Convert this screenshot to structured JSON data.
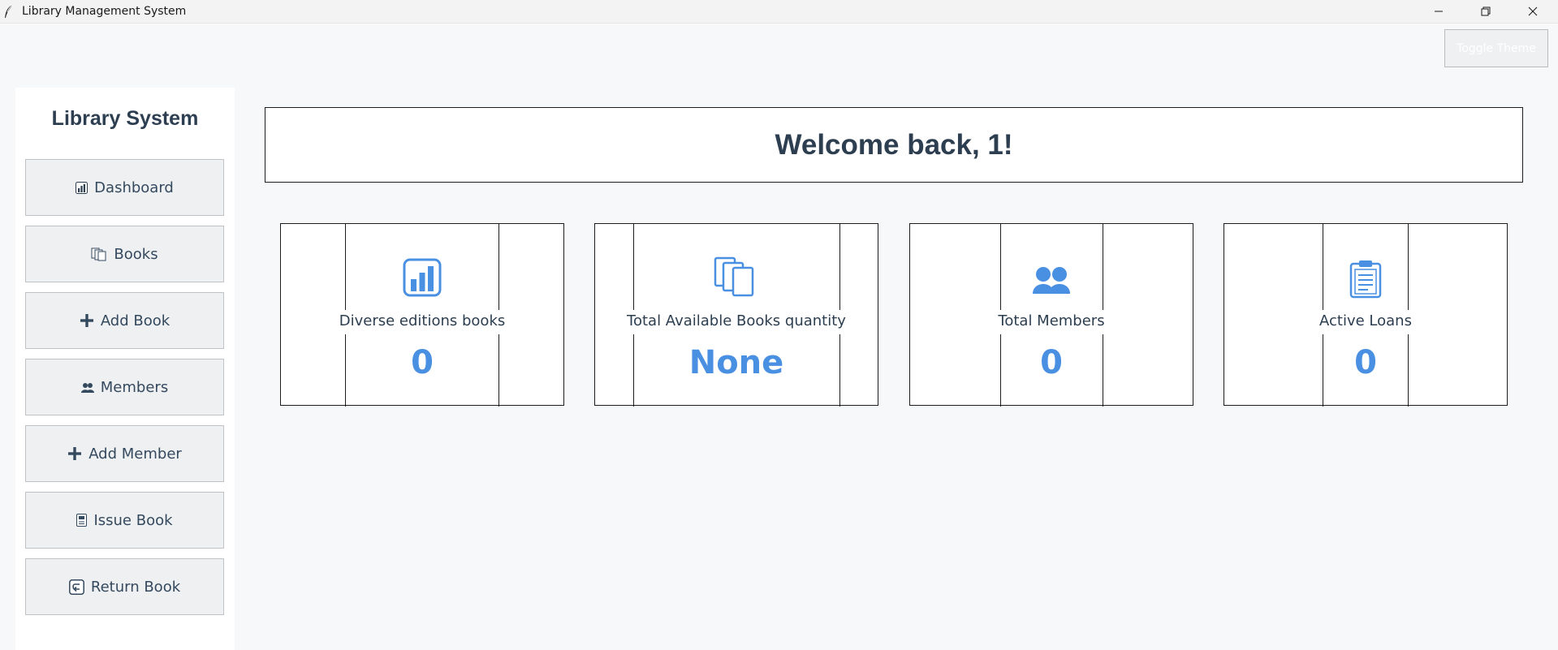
{
  "window": {
    "title": "Library Management System",
    "app_icon": "feather-icon",
    "controls": [
      "minimize-icon",
      "restore-icon",
      "close-icon"
    ]
  },
  "toolbar": {
    "toggle_theme_label": "Toggle Theme"
  },
  "sidebar": {
    "title": "Library System",
    "items": [
      {
        "label": "Dashboard",
        "icon": "bar-chart-icon"
      },
      {
        "label": "Books",
        "icon": "books-icon"
      },
      {
        "label": "Add Book",
        "icon": "plus-icon"
      },
      {
        "label": "Members",
        "icon": "members-icon"
      },
      {
        "label": "Add Member",
        "icon": "plus-icon"
      },
      {
        "label": "Issue Book",
        "icon": "ledger-icon"
      },
      {
        "label": "Return Book",
        "icon": "return-icon"
      }
    ]
  },
  "main": {
    "welcome": "Welcome back, 1!",
    "cards": [
      {
        "label": "Diverse editions books",
        "value": "0",
        "icon": "bar-chart-icon"
      },
      {
        "label": "Total Available Books quantity",
        "value": "None",
        "icon": "books-icon"
      },
      {
        "label": "Total Members",
        "value": "0",
        "icon": "members-icon"
      },
      {
        "label": "Active Loans",
        "value": "0",
        "icon": "clipboard-icon"
      }
    ]
  },
  "colors": {
    "accent": "#4a90e2",
    "text": "#2c3e50",
    "background": "#f7f8fa",
    "panel": "#ffffff",
    "button": "#eff0f2"
  }
}
